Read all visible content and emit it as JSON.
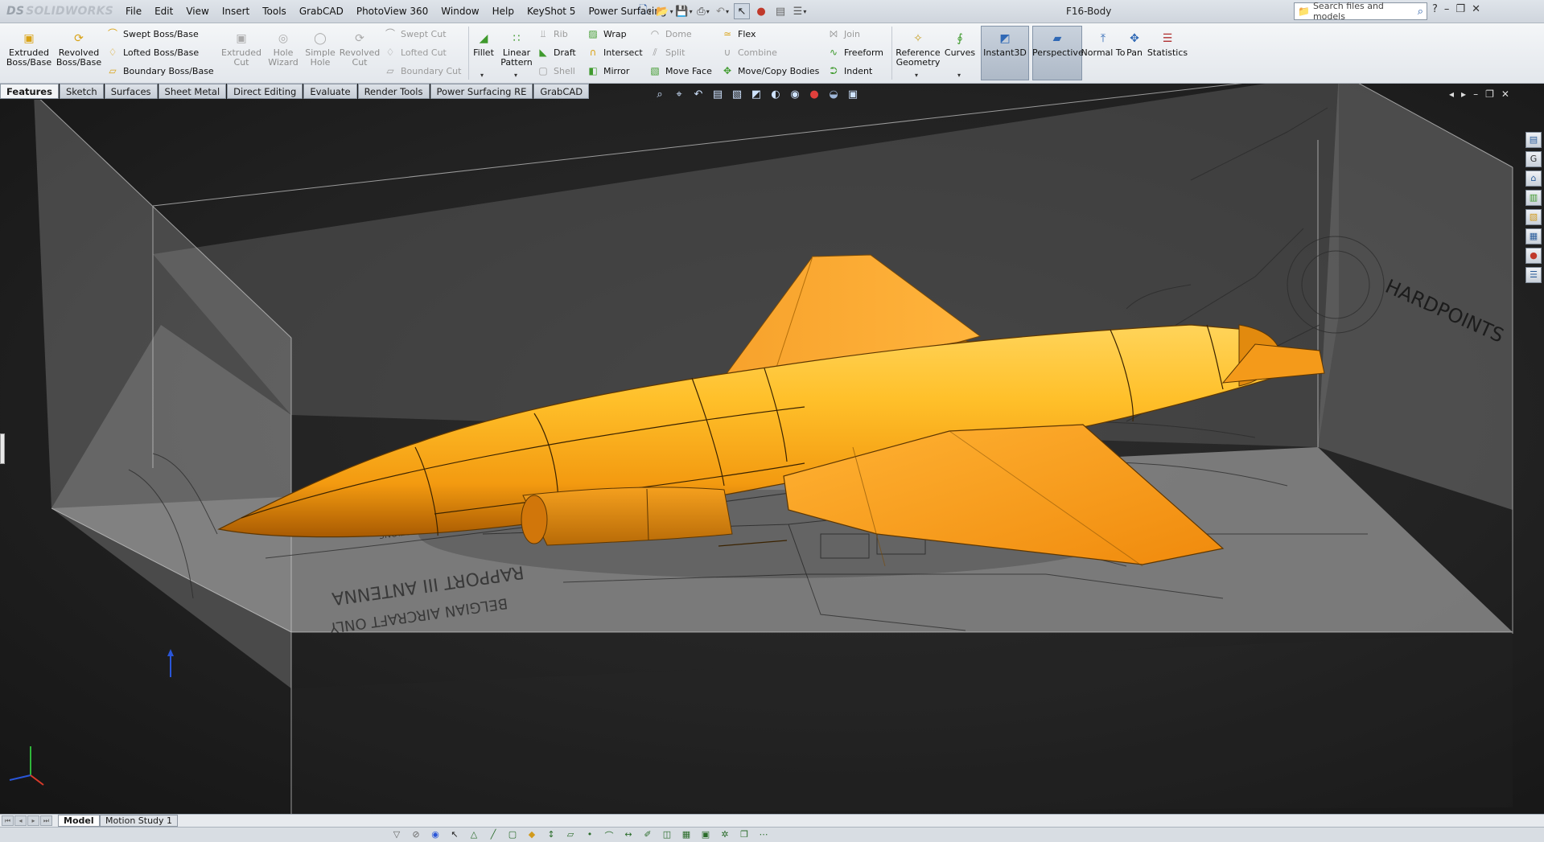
{
  "app": {
    "logo_text": "SOLIDWORKS",
    "logo_mark": "DS",
    "document_title": "F16-Body"
  },
  "menu": [
    "File",
    "Edit",
    "View",
    "Insert",
    "Tools",
    "GrabCAD",
    "PhotoView 360",
    "Window",
    "Help",
    "KeyShot 5",
    "Power Surfacing"
  ],
  "search": {
    "placeholder": "Search files and models"
  },
  "toolbar": {
    "extruded_boss": "Extruded Boss/Base",
    "revolved_boss": "Revolved Boss/Base",
    "swept_boss": "Swept Boss/Base",
    "lofted_boss": "Lofted Boss/Base",
    "boundary_boss": "Boundary Boss/Base",
    "extruded_cut": "Extruded Cut",
    "hole_wizard": "Hole Wizard",
    "simple_hole": "Simple Hole",
    "revolved_cut": "Revolved Cut",
    "swept_cut": "Swept Cut",
    "lofted_cut": "Lofted Cut",
    "boundary_cut": "Boundary Cut",
    "fillet": "Fillet",
    "linear_pattern": "Linear Pattern",
    "rib": "Rib",
    "draft": "Draft",
    "shell": "Shell",
    "wrap": "Wrap",
    "intersect": "Intersect",
    "mirror": "Mirror",
    "dome": "Dome",
    "split": "Split",
    "move_face": "Move Face",
    "flex": "Flex",
    "combine": "Combine",
    "move_copy": "Move/Copy Bodies",
    "join": "Join",
    "freeform": "Freeform",
    "indent": "Indent",
    "reference_geometry": "Reference Geometry",
    "curves": "Curves",
    "instant3d": "Instant3D",
    "perspective": "Perspective",
    "normal_to": "Normal To",
    "pan": "Pan",
    "statistics": "Statistics"
  },
  "tabs": [
    "Features",
    "Sketch",
    "Surfaces",
    "Sheet Metal",
    "Direct Editing",
    "Evaluate",
    "Render Tools",
    "Power Surfacing RE",
    "GrabCAD"
  ],
  "active_tab": "Features",
  "viewport": {
    "blueprint_label": "HARDPOINTS",
    "blueprint_text_1": "RAPPORT III ANTENNA",
    "blueprint_text_2": "BELGIAN AIRCRAFT ONLY",
    "blueprint_text_3": "WING CROSS SECTIONS",
    "model_color": "#f5a41a",
    "background_color": "#222222"
  },
  "bottom_tabs": [
    "Model",
    "Motion Study 1"
  ],
  "active_bottom_tab": "Model"
}
